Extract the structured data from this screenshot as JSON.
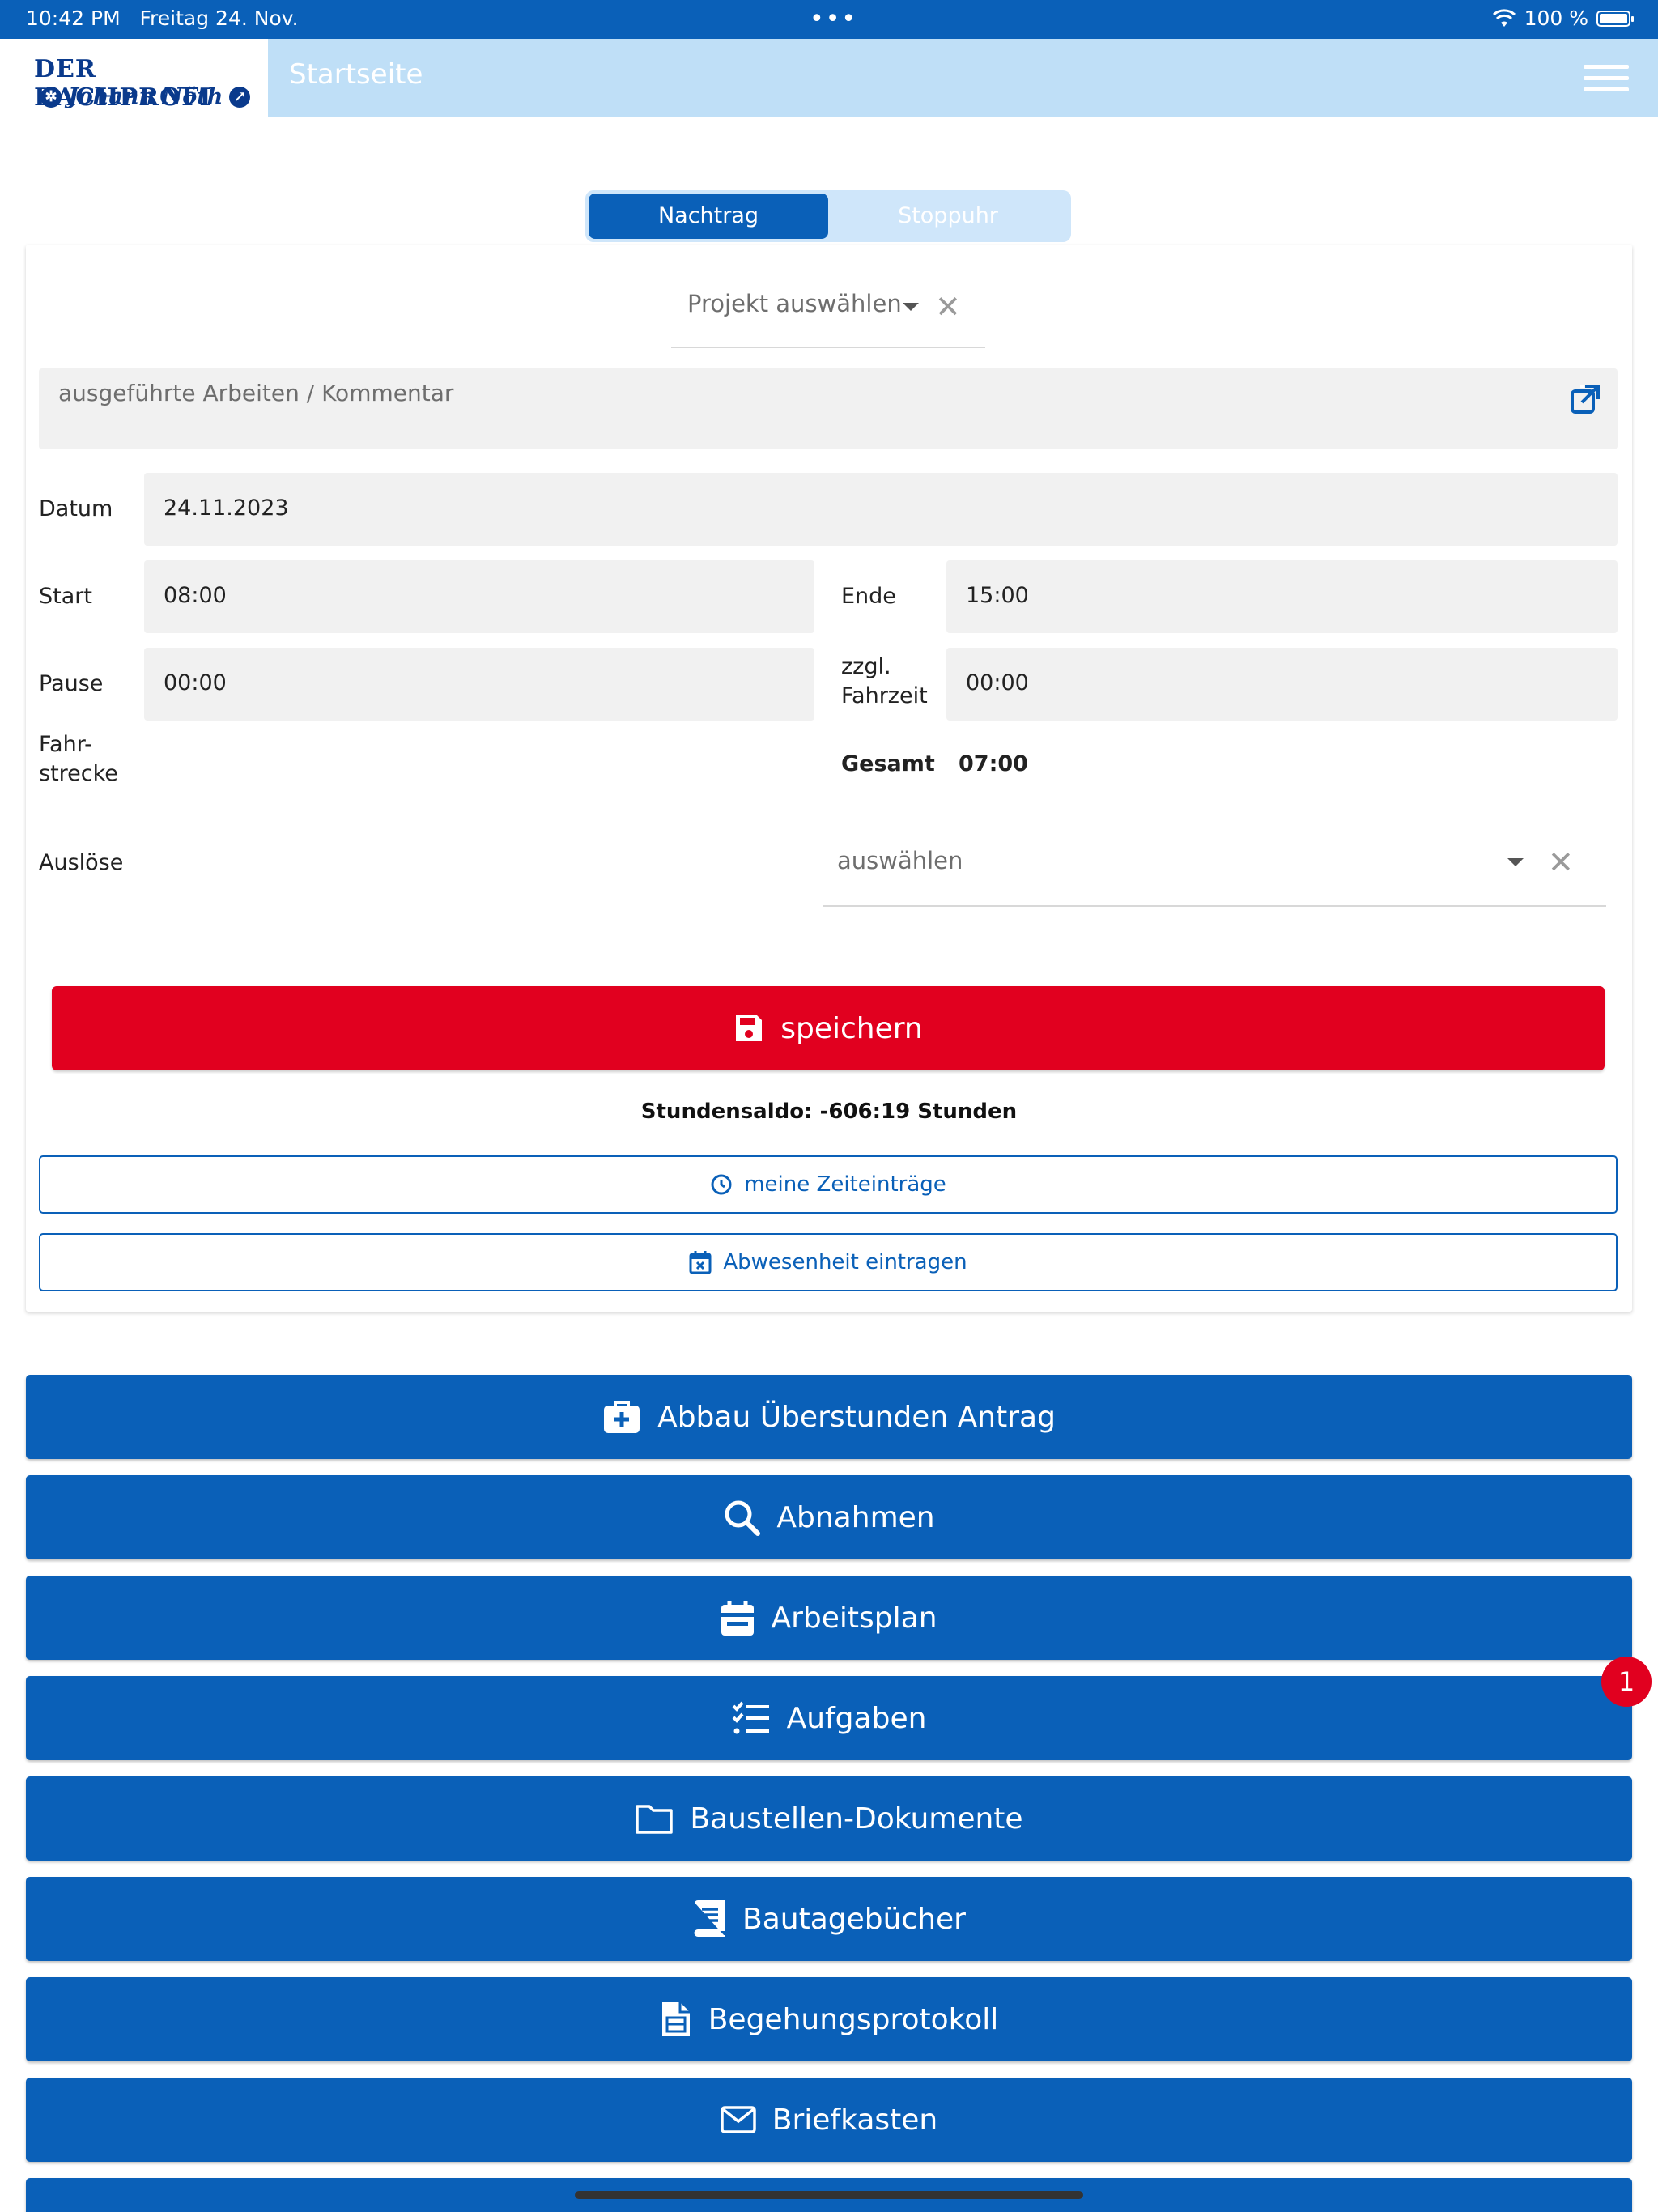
{
  "status_bar": {
    "time": "10:42 PM",
    "date": "Freitag 24. Nov.",
    "dots": "•••",
    "battery": "100 %"
  },
  "header": {
    "logo_line1": "DER DACHPROFI",
    "logo_line2": "Johann Nöth",
    "title": "Startseite",
    "menu_icon": "hamburger-icon"
  },
  "tabs": [
    {
      "label": "Nachtrag",
      "active": true
    },
    {
      "label": "Stoppuhr",
      "active": false
    }
  ],
  "form": {
    "project_placeholder": "Projekt auswählen",
    "comment_placeholder": "ausgeführte Arbeiten / Kommentar",
    "datum_label": "Datum",
    "datum_value": "24.11.2023",
    "start_label": "Start",
    "start_value": "08:00",
    "ende_label": "Ende",
    "ende_value": "15:00",
    "pause_label": "Pause",
    "pause_value": "00:00",
    "fahrzeit_label_1": "zzgl.",
    "fahrzeit_label_2": "Fahrzeit",
    "fahrzeit_value": "00:00",
    "fahrstrecke_label_1": "Fahr-",
    "fahrstrecke_label_2": "strecke",
    "gesamt_label": "Gesamt",
    "gesamt_value": "07:00",
    "ausloese_label": "Auslöse",
    "ausloese_placeholder": "auswählen",
    "save_label": "speichern",
    "saldo_text": "Stundensaldo: -606:19 Stunden",
    "zeiteintraege_label": "meine Zeiteinträge",
    "abwesenheit_label": "Abwesenheit eintragen"
  },
  "nav": [
    {
      "label": "Abbau Überstunden Antrag",
      "icon": "medkit-icon"
    },
    {
      "label": "Abnahmen",
      "icon": "search-icon"
    },
    {
      "label": "Arbeitsplan",
      "icon": "calendar-icon"
    },
    {
      "label": "Aufgaben",
      "icon": "checklist-icon",
      "badge": "1"
    },
    {
      "label": "Baustellen-Dokumente",
      "icon": "folder-icon"
    },
    {
      "label": "Bautagebücher",
      "icon": "book-icon"
    },
    {
      "label": "Begehungsprotokoll",
      "icon": "clipboard-icon"
    },
    {
      "label": "Briefkasten",
      "icon": "mail-icon"
    }
  ],
  "colors": {
    "primary": "#0a60b8",
    "header_light": "#bfdff7",
    "danger": "#e1001f"
  }
}
